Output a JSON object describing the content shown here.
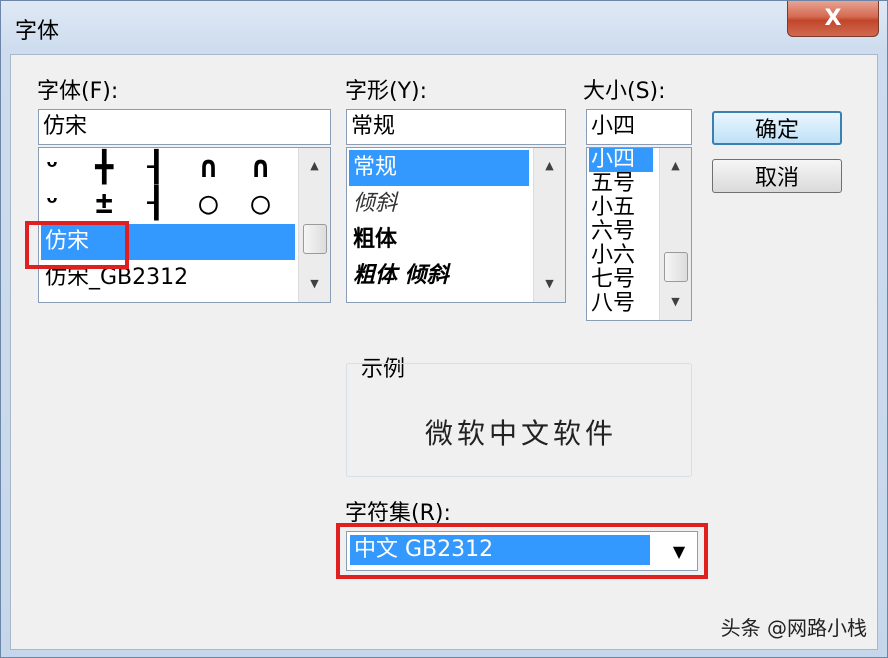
{
  "window": {
    "title": "字体",
    "close_label": "X"
  },
  "font": {
    "label": "字体(F):",
    "value": "仿宋",
    "items": [
      "ᵕ ╋ ┨ ∩ ∩ ┛ ┩",
      "ᵕ ± ┨ ◯ ◯ ▃",
      "仿宋",
      "仿宋_GB2312"
    ],
    "selected": "仿宋"
  },
  "style": {
    "label": "字形(Y):",
    "value": "常规",
    "items": [
      "常规",
      "倾斜",
      "粗体",
      "粗体 倾斜"
    ],
    "selected": "常规"
  },
  "size": {
    "label": "大小(S):",
    "value": "小四",
    "items": [
      "小四",
      "五号",
      "小五",
      "六号",
      "小六",
      "七号",
      "八号"
    ],
    "selected": "小四"
  },
  "buttons": {
    "ok": "确定",
    "cancel": "取消"
  },
  "sample": {
    "label": "示例",
    "text": "微软中文软件"
  },
  "charset": {
    "label": "字符集(R):",
    "value": "中文 GB2312"
  },
  "watermark": "头条 @网路小栈",
  "colors": {
    "selection": "#3399ff",
    "highlight_box": "#e02020"
  }
}
